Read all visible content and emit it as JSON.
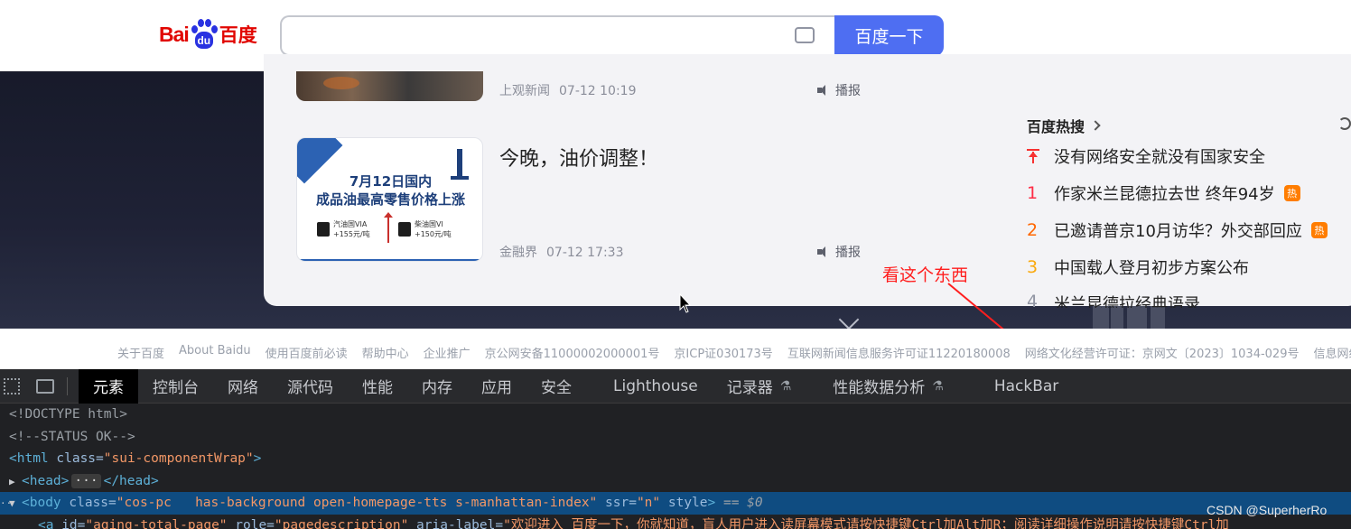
{
  "header": {
    "logo_text_left": "Bai",
    "logo_paw_text": "du",
    "logo_text_right": "百度",
    "search_value": "",
    "search_button": "百度一下"
  },
  "news": [
    {
      "source": "上观新闻",
      "time": "07-12 10:19",
      "listen": "播报"
    },
    {
      "headline": "今晚，油价调整！",
      "thumb_line1": "7月12日国内",
      "thumb_line2": "成品油最高零售价格上涨",
      "fuel_left": "汽油国VIA\n+155元/吨",
      "fuel_right": "柴油国VI\n+150元/吨",
      "source": "金融界",
      "time": "07-12 17:33",
      "listen": "播报"
    }
  ],
  "hot": {
    "title": "百度热搜",
    "items": [
      {
        "rank": "",
        "pinned": true,
        "text": "没有网络安全就没有国家安全",
        "badge": "",
        "rank_color": "#f73131"
      },
      {
        "rank": "1",
        "text": "作家米兰昆德拉去世 终年94岁",
        "badge": "热",
        "rank_color": "#fe2d46"
      },
      {
        "rank": "2",
        "text": "已邀请普京10月访华？外交部回应",
        "badge": "热",
        "rank_color": "#f60"
      },
      {
        "rank": "3",
        "text": "中国载人登月初步方案公布",
        "badge": "",
        "rank_color": "#faa90e"
      },
      {
        "rank": "4",
        "text": "米兰昆德拉经典语录",
        "badge": "",
        "rank_color": "#9195a3"
      }
    ]
  },
  "annotation": "看这个东西",
  "footer_links": [
    "关于百度",
    "About Baidu",
    "使用百度前必读",
    "帮助中心",
    "企业推广",
    "京公网安备11000002000001号",
    "京ICP证030173号",
    "互联网新闻信息服务许可证11220180008",
    "网络文化经营许可证：京网文〔2023〕1034-029号",
    "信息网络"
  ],
  "devtools": {
    "tabs": [
      "元素",
      "控制台",
      "网络",
      "源代码",
      "性能",
      "内存",
      "应用",
      "安全",
      "Lighthouse",
      "记录器",
      "性能数据分析",
      "HackBar"
    ],
    "active_tab": "元素",
    "lines": {
      "l1": "<!DOCTYPE html>",
      "l2": "<!--STATUS OK-->",
      "l3_tag": "<html",
      "l3_attr": " class=",
      "l3_val": "\"sui-componentWrap\"",
      "l3_end": ">",
      "l4_open": "<head>",
      "l4_dots": "···",
      "l4_close": "</head>",
      "l5_tag": "<body",
      "l5_attr1": " class=",
      "l5_val1": "\"cos-pc   has-background open-homepage-tts s-manhattan-index\"",
      "l5_attr2": " ssr=",
      "l5_val2": "\"n\"",
      "l5_attr3": " style",
      "l5_end": ">",
      "l5_eq": " == $0",
      "l6_tag": "<a",
      "l6_attr1": " id=",
      "l6_val1": "\"aging-total-page\"",
      "l6_attr2": " role=",
      "l6_val2": "\"pagedescription\"",
      "l6_attr3": " aria-label=",
      "l6_val3": "\"欢迎进入 百度一下，你就知道，盲人用户进入读屏幕模式请按快捷键Ctrl加Alt加R；阅读详细操作说明请按快捷键Ctrl加"
    }
  },
  "watermark": "CSDN @SuperherRo"
}
